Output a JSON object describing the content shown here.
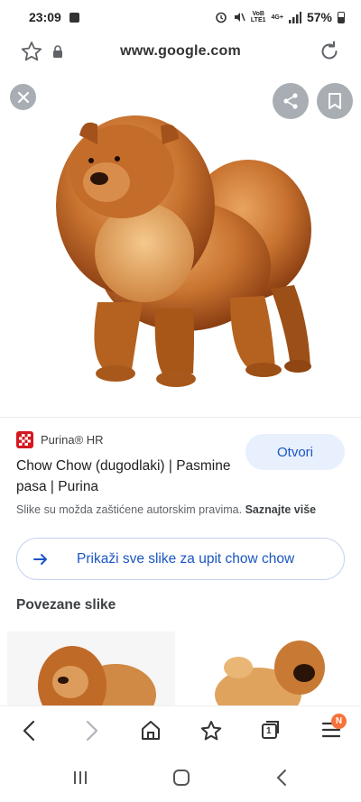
{
  "status_bar": {
    "time": "23:09",
    "signal_label_top": "VoB",
    "signal_label_bottom": "LTE1",
    "network": "4G+",
    "battery": "57%"
  },
  "address_bar": {
    "url": "www.google.com"
  },
  "image_viewer": {
    "close_icon": "close-icon",
    "share_icon": "share-icon",
    "save_icon": "bookmark-icon"
  },
  "result": {
    "source": "Purina® HR",
    "title": "Chow Chow (dugodlaki) | Pasmine pasa | Purina",
    "open_button": "Otvori",
    "copyright_text": "Slike su možda zaštićene autorskim pravima.",
    "copyright_link": "Saznajte više"
  },
  "show_all": {
    "label": "Prikaži sve slike za upit chow chow"
  },
  "related": {
    "title": "Povezane slike"
  },
  "bottom_nav": {
    "tabs_count": "1",
    "menu_badge": "N"
  },
  "colors": {
    "accent": "#1a56c2",
    "accent_bg": "#e8f0fe",
    "badge": "#f5733b",
    "purina_red": "#d5181f"
  }
}
